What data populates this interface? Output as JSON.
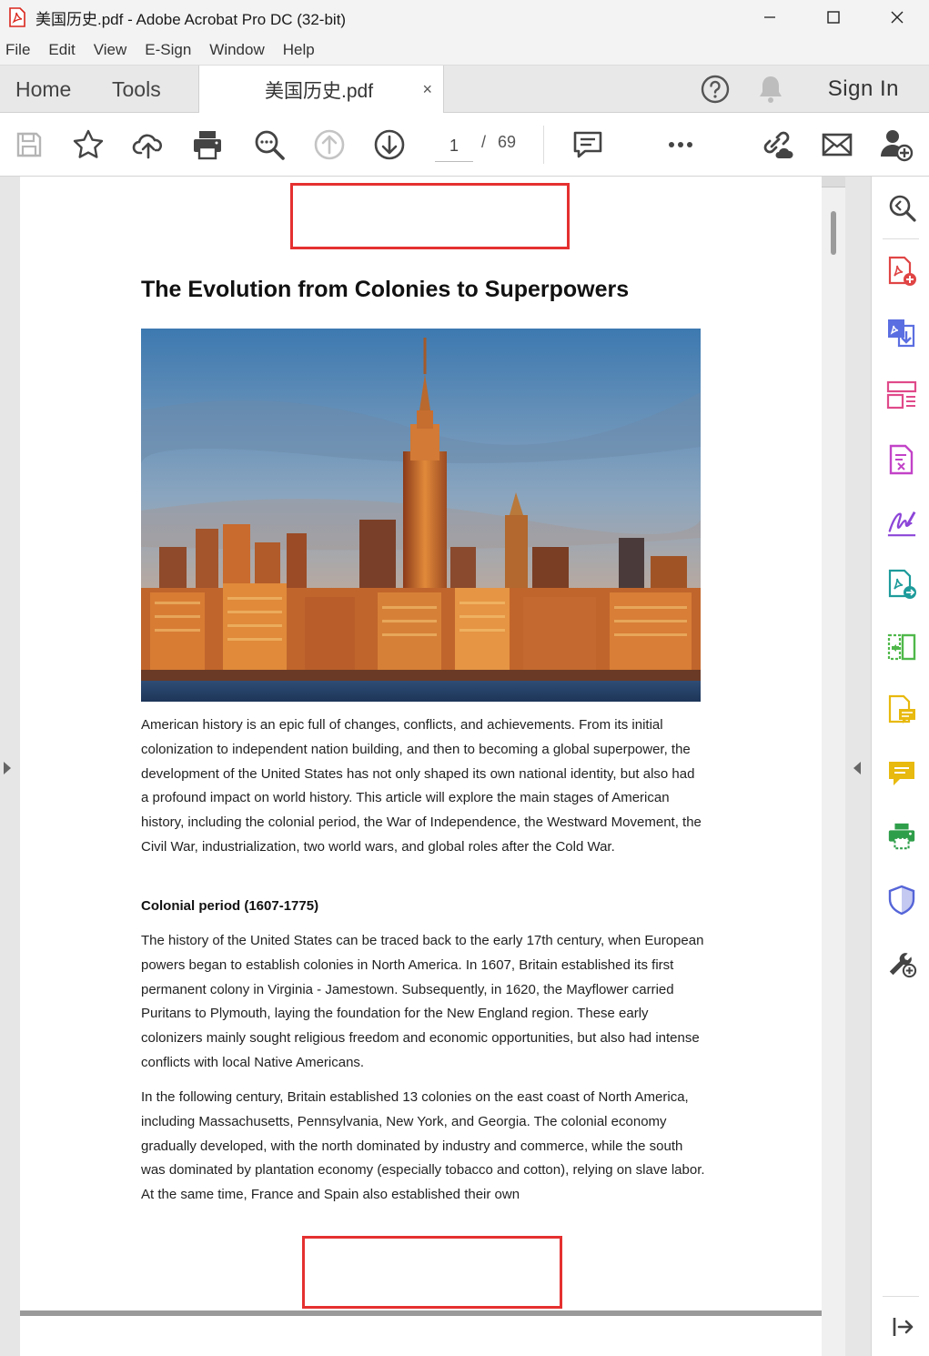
{
  "window": {
    "title": "美国历史.pdf - Adobe Acrobat Pro DC (32-bit)"
  },
  "menu": [
    "File",
    "Edit",
    "View",
    "E-Sign",
    "Window",
    "Help"
  ],
  "tabs": {
    "home": "Home",
    "tools": "Tools",
    "document": "美国历史.pdf",
    "close": "×",
    "sign_in": "Sign In"
  },
  "toolbar": {
    "current_page": "1",
    "page_separator": "/",
    "total_pages": "69",
    "more": "•••"
  },
  "document": {
    "title": "The Evolution from Colonies to Superpowers",
    "intro": "American history is an epic full of changes, conflicts, and achievements. From its initial colonization to independent nation building, and then to becoming a global superpower, the development of the United States has not only shaped its own national identity, but also had a profound impact on world history. This article will explore the main stages of American history, including the colonial period, the War of Independence, the Westward Movement, the Civil War, industrialization, two world wars, and global roles after the Cold War.",
    "section_heading": "Colonial period (1607-1775)",
    "para1": "The history of the United States can be traced back to the early 17th century, when European powers began to establish colonies in North America. In 1607, Britain established its first permanent colony in Virginia - Jamestown. Subsequently, in 1620, the Mayflower carried Puritans to Plymouth, laying the foundation for the New England region. These early colonizers mainly sought religious freedom and economic opportunities, but also had intense conflicts with local Native Americans.",
    "para2": "In the following century, Britain established 13 colonies on the east coast of North America, including Massachusetts, Pennsylvania, New York, and Georgia. The colonial economy gradually developed, with the north dominated by industry and commerce, while the south was dominated by plantation economy (especially tobacco and cotton), relying on slave labor. At the same time, France and Spain also established their own"
  },
  "colors": {
    "annotation_red": "#e53030",
    "acrobat_red": "#d9261c"
  }
}
